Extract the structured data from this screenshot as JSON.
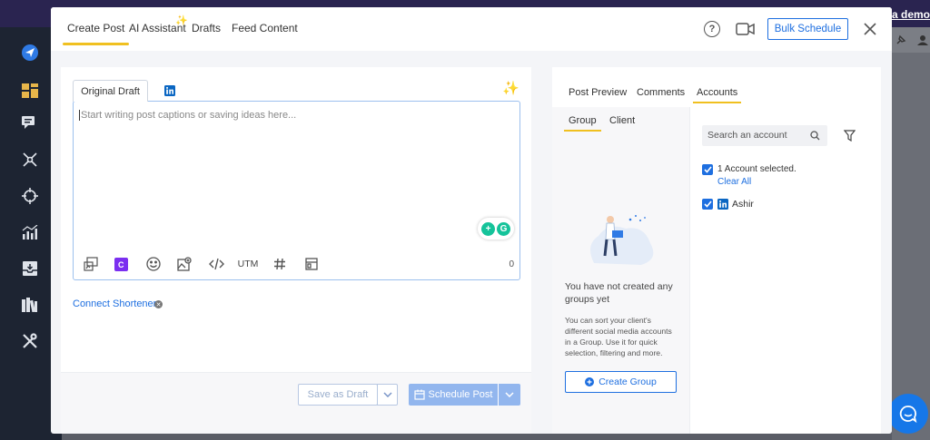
{
  "background": {
    "demo_link": "e a demo"
  },
  "header": {
    "tabs": [
      "Create Post",
      "AI Assistant",
      "Drafts",
      "Feed Content"
    ],
    "help_label": "?",
    "bulk_schedule": "Bulk Schedule"
  },
  "composer": {
    "draft_tab": "Original Draft",
    "placeholder": "Start writing post captions or saving ideas here...",
    "utm_label": "UTM",
    "char_count": "0",
    "connect_shortener": "Connect Shortener",
    "save_draft": "Save as Draft",
    "schedule_post": "Schedule Post"
  },
  "preview": {
    "tabs": [
      "Post Preview",
      "Comments",
      "Accounts"
    ],
    "group_tabs": [
      "Group",
      "Client"
    ],
    "empty_title": "You have not created any groups yet",
    "empty_desc": "You can sort your client's different social media accounts in a Group. Use it for quick selection, filtering and more.",
    "create_group": "Create Group",
    "search_placeholder": "Search an account",
    "selected_text": "1 Account selected.",
    "clear_all": "Clear All",
    "account_name": "Ashir"
  },
  "colors": {
    "accent": "#1e6fe0",
    "tab_underline": "#f0c020",
    "linkedin": "#0a66c2"
  }
}
